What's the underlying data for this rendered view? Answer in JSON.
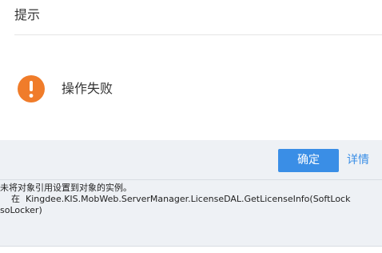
{
  "dialog": {
    "title": "提示",
    "icon": "warning-exclamation-icon",
    "message": "操作失败",
    "ok_label": "确定",
    "details_label": "详情",
    "detail_text": "未将对象引用设置到对象的实例。\n    在  Kingdee.KIS.MobWeb.ServerManager.LicenseDAL.GetLicenseInfo(SoftLock\nsoLocker)"
  },
  "colors": {
    "accent": "#3a8ee6",
    "warning": "#f07c2a",
    "footer_bg": "#eef1f5"
  }
}
